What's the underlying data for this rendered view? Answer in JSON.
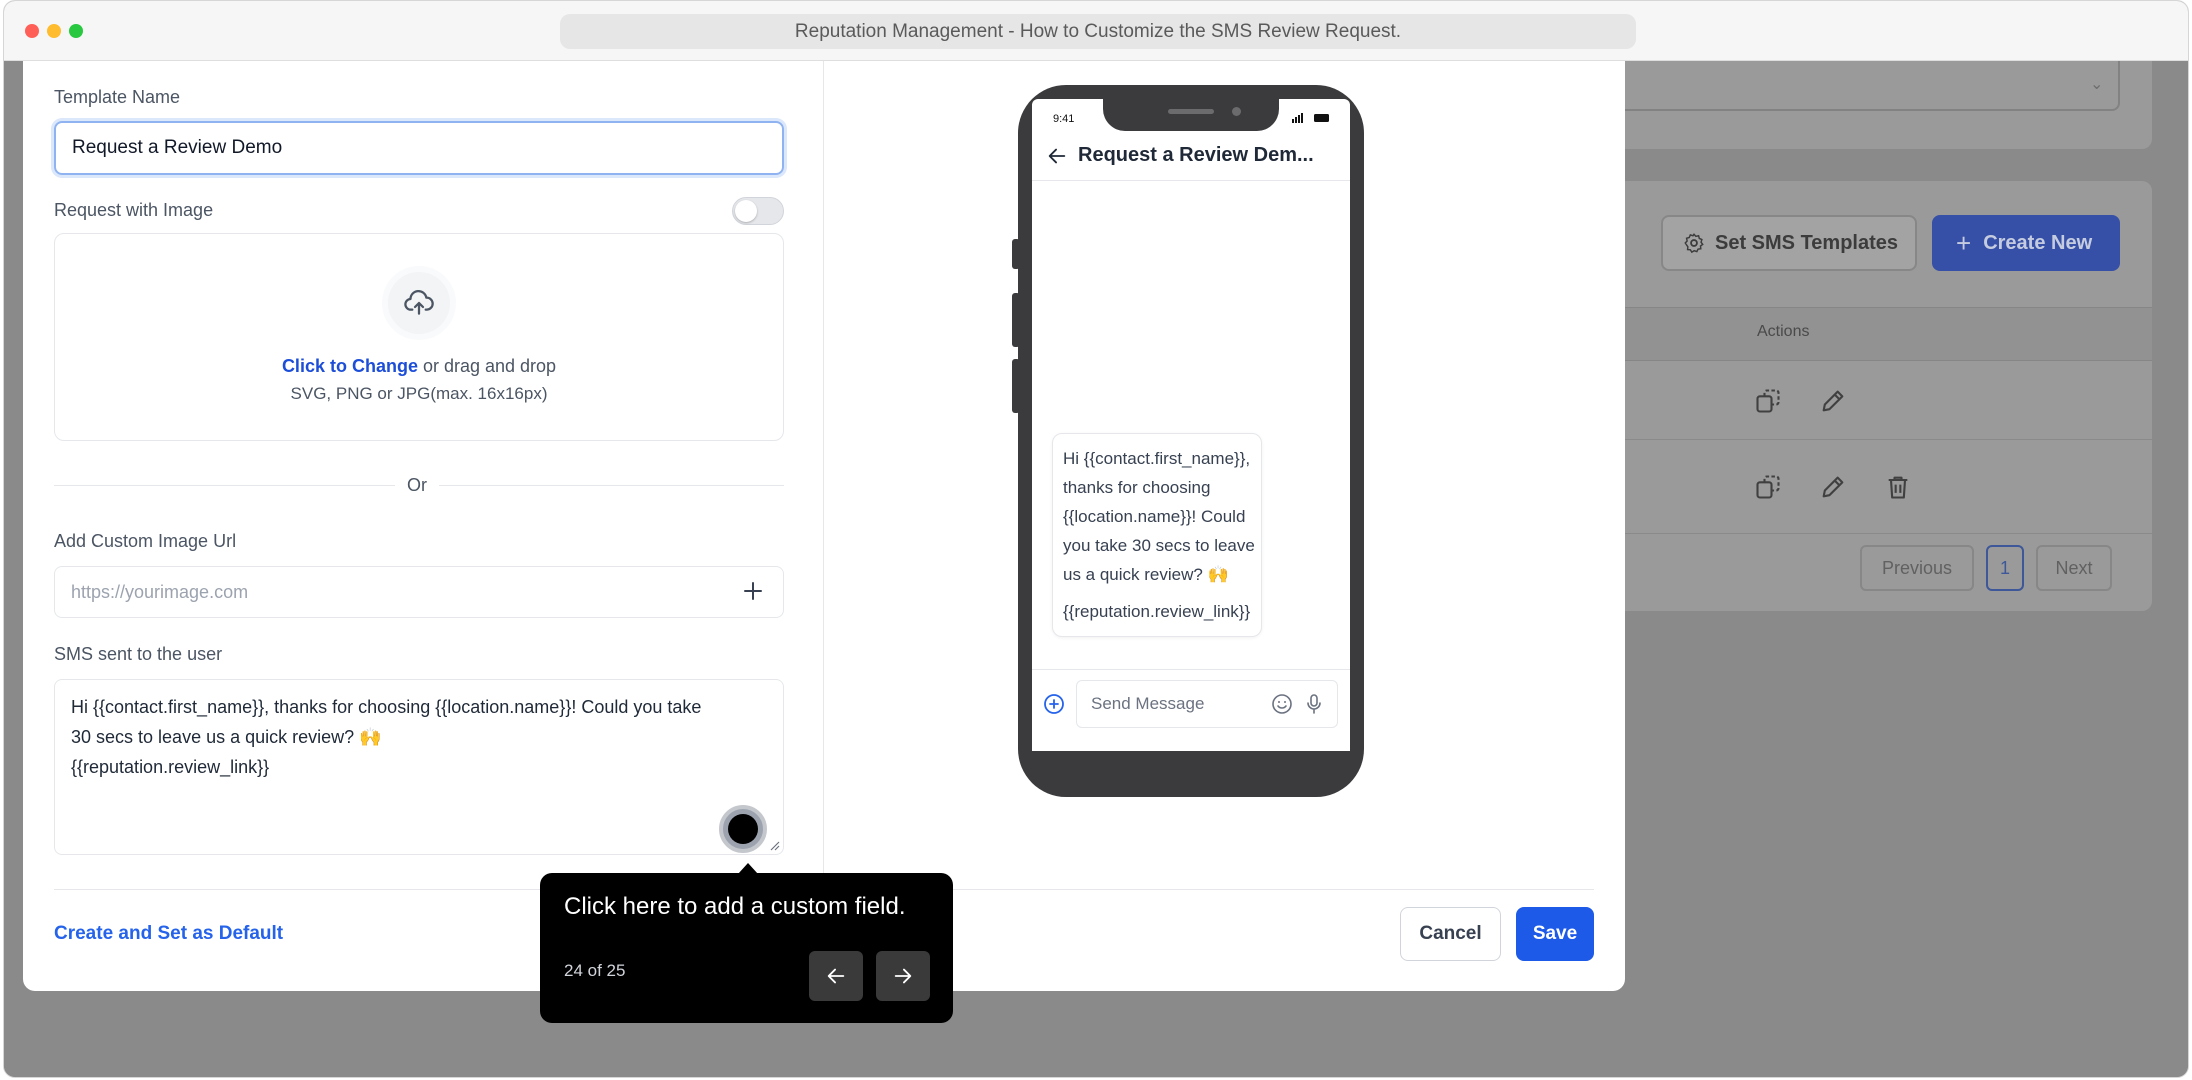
{
  "browser": {
    "title": "Reputation Management - How to Customize the SMS Review Request."
  },
  "background": {
    "set_templates_label": "Set SMS Templates",
    "create_new_label": "Create New",
    "actions_header": "Actions",
    "pagination": {
      "previous": "Previous",
      "page": "1",
      "next": "Next"
    }
  },
  "form": {
    "template_name_label": "Template Name",
    "template_name_value": "Request a Review Demo",
    "request_with_image_label": "Request with Image",
    "request_with_image_on": false,
    "upload": {
      "link_text": "Click to Change",
      "rest_text": " or drag and drop",
      "hint": "SVG, PNG or JPG(max. 16x16px)"
    },
    "or_text": "Or",
    "custom_image_url_label": "Add Custom Image Url",
    "custom_image_url_placeholder": "https://yourimage.com",
    "sms_label": "SMS sent to the user",
    "sms_lines": [
      "Hi {{contact.first_name}}, thanks for choosing {{location.name}}! Could you take",
      "30 secs to leave us a quick review? 🙌",
      "{{reputation.review_link}}"
    ]
  },
  "footer": {
    "create_default_label": "Create and Set as Default",
    "cancel_label": "Cancel",
    "save_label": "Save"
  },
  "preview": {
    "status_time": "9:41",
    "chat_title": "Request a Review Dem...",
    "bubble_lines": [
      "Hi {{contact.first_name}},",
      "thanks for choosing",
      "{{location.name}}! Could",
      "you take 30 secs to leave",
      "us a quick review? 🙌"
    ],
    "bubble_link": "{{reputation.review_link}}",
    "compose_placeholder": "Send Message"
  },
  "guide": {
    "text": "Click here to add a custom field.",
    "step": "24 of 25"
  },
  "colors": {
    "primary": "#1d5ae8",
    "link": "#2563eb",
    "tooltip_bg": "#000000"
  }
}
